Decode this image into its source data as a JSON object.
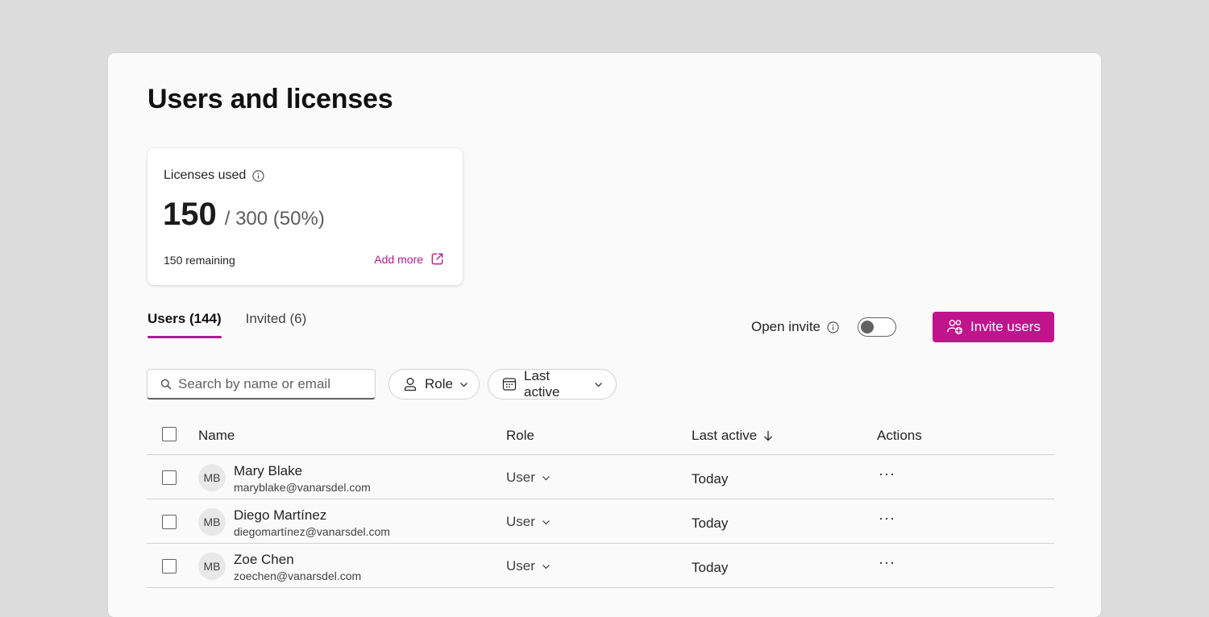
{
  "page": {
    "title": "Users and licenses"
  },
  "licenses": {
    "label": "Licenses used",
    "used": "150",
    "total_text": "/ 300 (50%)",
    "remaining": "150 remaining",
    "add_more": "Add more"
  },
  "tabs": [
    {
      "label": "Users (144)",
      "active": true
    },
    {
      "label": "Invited (6)",
      "active": false
    }
  ],
  "open_invite": {
    "label": "Open invite",
    "enabled": false
  },
  "invite_button": {
    "label": "Invite users"
  },
  "search": {
    "placeholder": "Search by name or email"
  },
  "filters": {
    "role": "Role",
    "last_active": "Last active"
  },
  "table": {
    "columns": {
      "name": "Name",
      "role": "Role",
      "last_active": "Last active",
      "actions": "Actions"
    },
    "rows": [
      {
        "initials": "MB",
        "name": "Mary Blake",
        "email": "maryblake@vanarsdel.com",
        "role": "User",
        "last_active": "Today",
        "actions": "···"
      },
      {
        "initials": "MB",
        "name": "Diego Martínez",
        "email": "diegomartínez@vanarsdel.com",
        "role": "User",
        "last_active": "Today",
        "actions": "···"
      },
      {
        "initials": "MB",
        "name": "Zoe Chen",
        "email": "zoechen@vanarsdel.com",
        "role": "User",
        "last_active": "Today",
        "actions": "···"
      }
    ]
  },
  "colors": {
    "accent": "#c0148c",
    "link": "#b4198c",
    "background": "#dcdcdc",
    "panel": "#fafafa"
  },
  "icons": [
    "info-icon",
    "external-link-icon",
    "invite-users-icon",
    "search-icon",
    "person-icon",
    "calendar-icon",
    "chevron-down-icon",
    "arrow-down-icon",
    "more-icon"
  ]
}
